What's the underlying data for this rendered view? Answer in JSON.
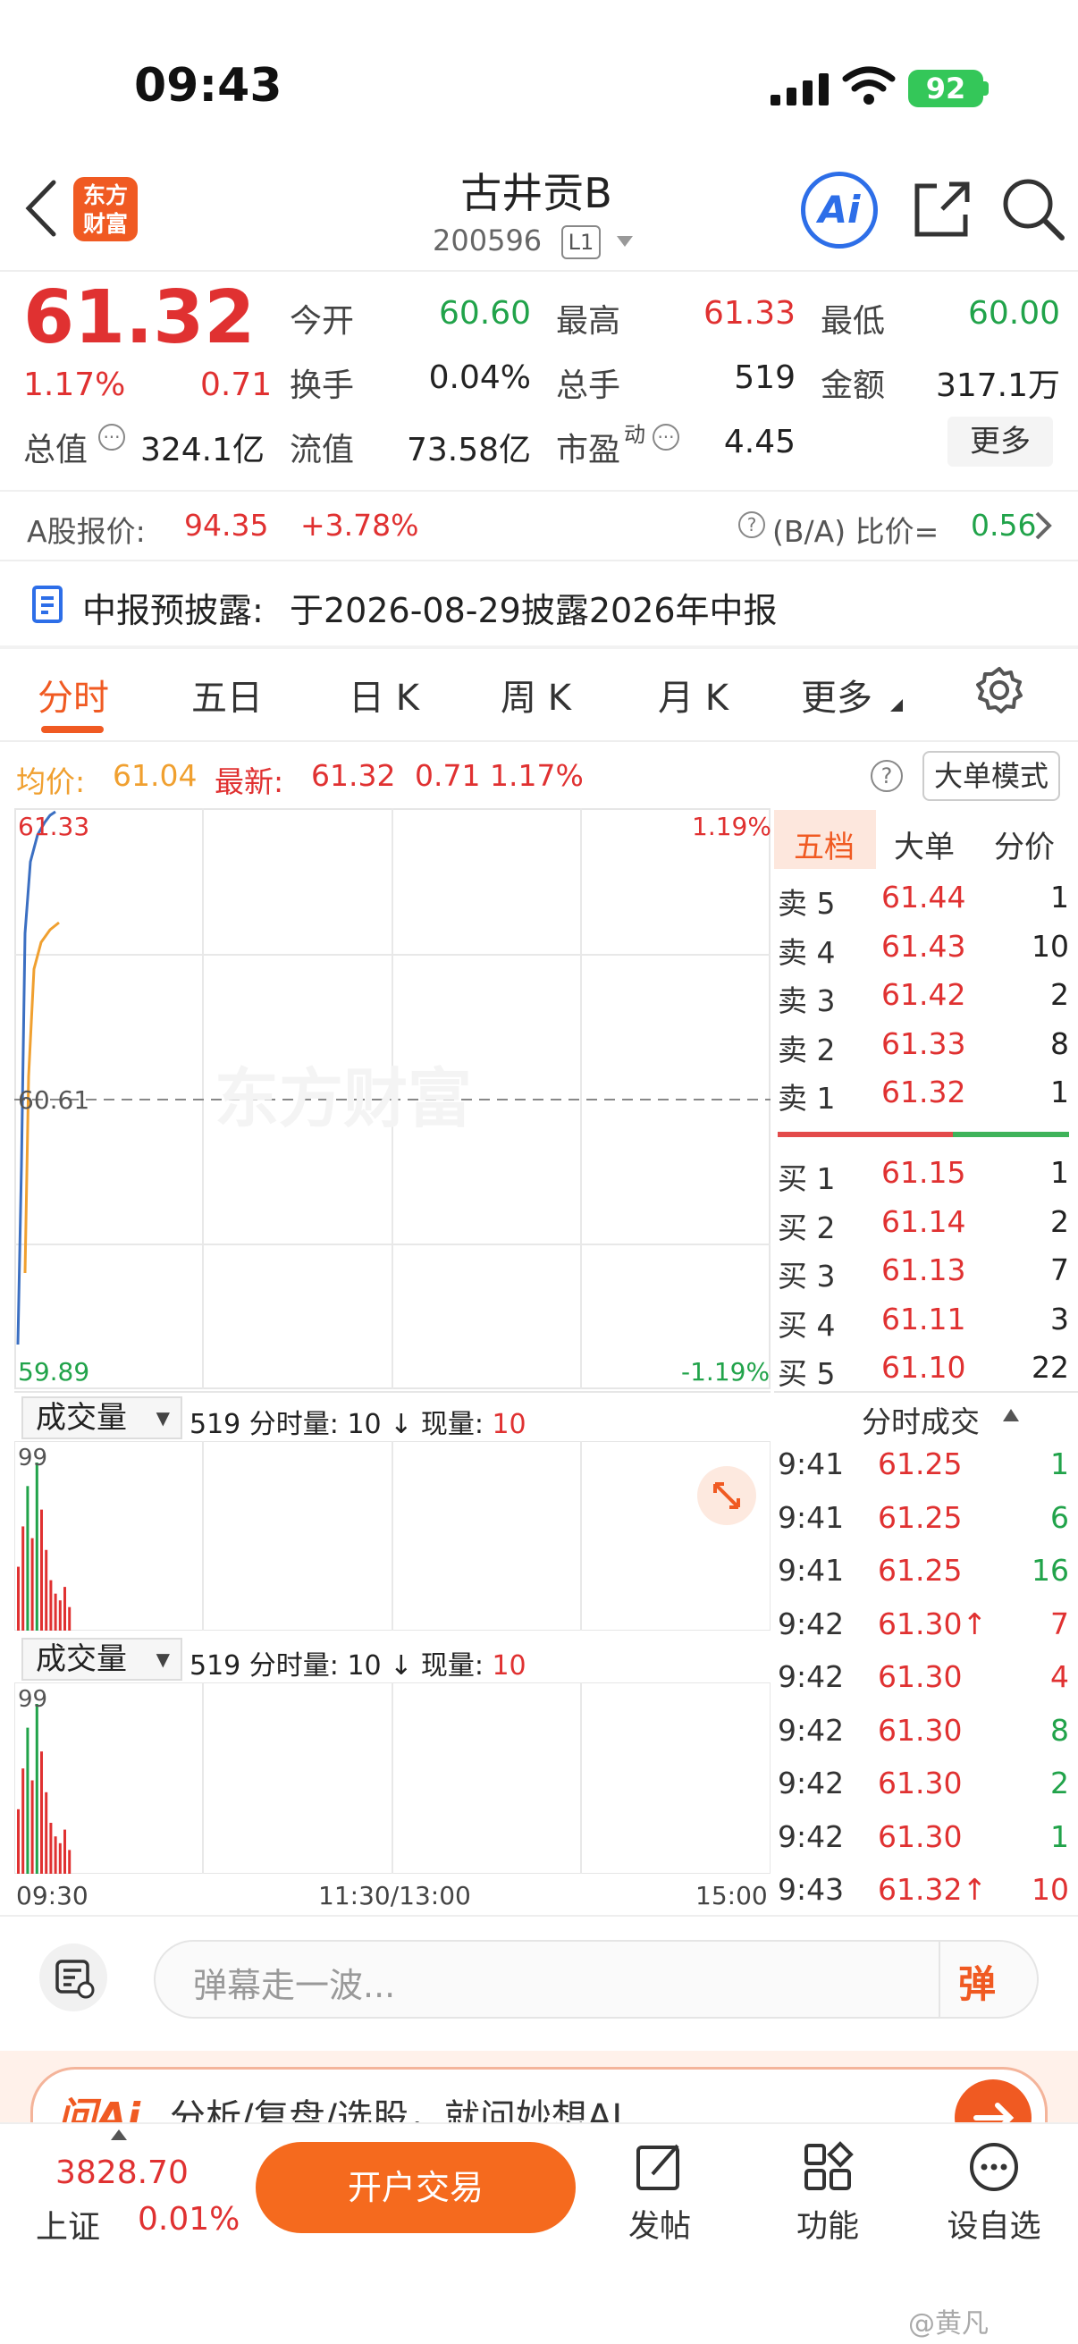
{
  "status": {
    "time": "09:43",
    "battery": "92"
  },
  "nav": {
    "logo_line1": "东方",
    "logo_line2": "财富",
    "title": "古井贡B",
    "code": "200596",
    "level": "L1",
    "ai": "Ai"
  },
  "quote": {
    "price": "61.32",
    "pct": "1.17%",
    "change": "0.71",
    "open_label": "今开",
    "open": "60.60",
    "high_label": "最高",
    "high": "61.33",
    "low_label": "最低",
    "low": "60.00",
    "turnover_label": "换手",
    "turnover": "0.04%",
    "volume_label": "总手",
    "volume": "519",
    "amount_label": "金额",
    "amount": "317.1万",
    "mktcap_label": "总值",
    "mktcap": "324.1亿",
    "float_label": "流值",
    "float_cap": "73.58亿",
    "pe_label": "市盈",
    "pe_sup": "动",
    "pe": "4.45",
    "more": "更多"
  },
  "ashare": {
    "label": "A股报价:",
    "price": "94.35",
    "pct": "+3.78%",
    "ratio_label": "(B/A) 比价=",
    "ratio": "0.56"
  },
  "notice": {
    "label": "中报预披露:",
    "text": "于2026-08-29披露2026年中报"
  },
  "tabs": [
    "分时",
    "五日",
    "日 K",
    "周 K",
    "月 K",
    "更多"
  ],
  "avgrow": {
    "avg_label": "均价:",
    "avg": "61.04",
    "latest_label": "最新:",
    "latest": "61.32",
    "chg": "0.71",
    "pct": "1.17%",
    "bigmode": "大单模式"
  },
  "chart": {
    "top_price": "61.33",
    "mid_price": "60.61",
    "bottom_price": "59.89",
    "top_pct": "1.19%",
    "bottom_pct": "-1.19%",
    "watermark": "东方财富",
    "x_start": "09:30",
    "x_mid": "11:30/13:00",
    "x_end": "15:00"
  },
  "volume_panel": {
    "label": "成交量",
    "info_prefix": "519 分时量: 10 ↓ 现量: ",
    "info_now": "10",
    "max": "99"
  },
  "orderbook": {
    "tabs": [
      "五档",
      "大单",
      "分价"
    ],
    "sells": [
      {
        "k": "卖 5",
        "p": "61.44",
        "q": "1"
      },
      {
        "k": "卖 4",
        "p": "61.43",
        "q": "10"
      },
      {
        "k": "卖 3",
        "p": "61.42",
        "q": "2"
      },
      {
        "k": "卖 2",
        "p": "61.33",
        "q": "8"
      },
      {
        "k": "卖 1",
        "p": "61.32",
        "q": "1"
      }
    ],
    "buys": [
      {
        "k": "买 1",
        "p": "61.15",
        "q": "1"
      },
      {
        "k": "买 2",
        "p": "61.14",
        "q": "2"
      },
      {
        "k": "买 3",
        "p": "61.13",
        "q": "7"
      },
      {
        "k": "买 4",
        "p": "61.11",
        "q": "3"
      },
      {
        "k": "买 5",
        "p": "61.10",
        "q": "22"
      }
    ]
  },
  "ticks": {
    "title": "分时成交",
    "rows": [
      {
        "t": "9:41",
        "p": "61.25",
        "q": "1",
        "dir": "green"
      },
      {
        "t": "9:41",
        "p": "61.25",
        "q": "6",
        "dir": "green"
      },
      {
        "t": "9:41",
        "p": "61.25",
        "q": "16",
        "dir": "green"
      },
      {
        "t": "9:42",
        "p": "61.30↑",
        "q": "7",
        "dir": "red"
      },
      {
        "t": "9:42",
        "p": "61.30",
        "q": "4",
        "dir": "red"
      },
      {
        "t": "9:42",
        "p": "61.30",
        "q": "8",
        "dir": "green"
      },
      {
        "t": "9:42",
        "p": "61.30",
        "q": "2",
        "dir": "green"
      },
      {
        "t": "9:42",
        "p": "61.30",
        "q": "1",
        "dir": "green"
      },
      {
        "t": "9:43",
        "p": "61.32↑",
        "q": "10",
        "dir": "red"
      }
    ]
  },
  "comment": {
    "placeholder": "弹幕走一波...",
    "danmu": "弹"
  },
  "ai_banner": {
    "logo": "问Ai",
    "text": "分析/复盘/选股，就问妙想AI"
  },
  "bottom": {
    "index_value": "3828.70",
    "index_name": "上证",
    "index_pct": "0.01%",
    "trade": "开户交易",
    "post": "发帖",
    "func": "功能",
    "watch": "设自选"
  },
  "watermark": "@黄凡",
  "colors": {
    "up": "#e03131",
    "down": "#21a34a",
    "brand": "#f05a22",
    "avg_line": "#f0a030",
    "price_line": "#3b6fc2"
  }
}
